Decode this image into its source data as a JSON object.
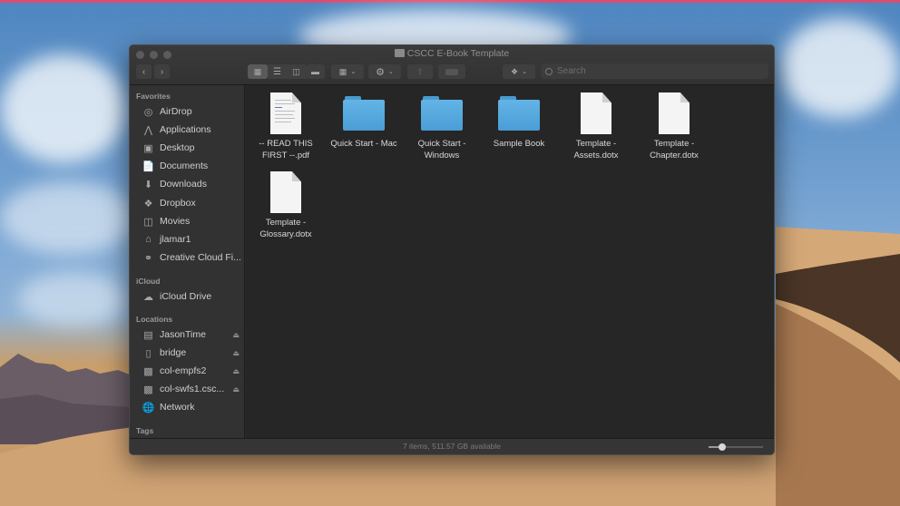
{
  "desktop": {
    "accent_line": "#d94d72"
  },
  "window": {
    "title": "CSCC E-Book Template",
    "toolbar": {
      "back_icon": "chevron-left",
      "forward_icon": "chevron-right",
      "view_modes": [
        "icon-view",
        "list-view",
        "column-view",
        "gallery-view"
      ],
      "selected_view": "icon-view",
      "group_icon": "group-grid",
      "action_icon": "gear",
      "share_icon": "share",
      "tags_icon": "tag",
      "dropbox_icon": "dropbox",
      "search_placeholder": "Search"
    },
    "sidebar": {
      "favorites_label": "Favorites",
      "favorites": [
        {
          "label": "AirDrop",
          "icon": "airdrop"
        },
        {
          "label": "Applications",
          "icon": "applications"
        },
        {
          "label": "Desktop",
          "icon": "desktop"
        },
        {
          "label": "Documents",
          "icon": "documents"
        },
        {
          "label": "Downloads",
          "icon": "downloads"
        },
        {
          "label": "Dropbox",
          "icon": "dropbox"
        },
        {
          "label": "Movies",
          "icon": "movies"
        },
        {
          "label": "jlamar1",
          "icon": "home"
        },
        {
          "label": "Creative Cloud Fi...",
          "icon": "creative-cloud"
        }
      ],
      "icloud_label": "iCloud",
      "icloud": [
        {
          "label": "iCloud Drive",
          "icon": "cloud"
        }
      ],
      "locations_label": "Locations",
      "locations": [
        {
          "label": "JasonTime",
          "icon": "time-machine",
          "ejectable": true
        },
        {
          "label": "bridge",
          "icon": "drive",
          "ejectable": true
        },
        {
          "label": "col-empfs2",
          "icon": "server",
          "ejectable": true
        },
        {
          "label": "col-swfs1.csc...",
          "icon": "server",
          "ejectable": true
        },
        {
          "label": "Network",
          "icon": "network",
          "ejectable": false
        }
      ],
      "tags_label": "Tags"
    },
    "files": [
      {
        "name": "-- READ THIS FIRST --.pdf",
        "line1": "-- READ THIS",
        "line2": "FIRST --.pdf",
        "type": "pdf"
      },
      {
        "name": "Quick Start - Mac",
        "line1": "Quick Start - Mac",
        "line2": "",
        "type": "folder"
      },
      {
        "name": "Quick Start - Windows",
        "line1": "Quick Start -",
        "line2": "Windows",
        "type": "folder"
      },
      {
        "name": "Sample Book",
        "line1": "Sample Book",
        "line2": "",
        "type": "folder"
      },
      {
        "name": "Template - Assets.dotx",
        "line1": "Template -",
        "line2": "Assets.dotx",
        "type": "dotx"
      },
      {
        "name": "Template - Chapter.dotx",
        "line1": "Template -",
        "line2": "Chapter.dotx",
        "type": "dotx"
      },
      {
        "name": "Template - Glossary.dotx",
        "line1": "Template -",
        "line2": "Glossary.dotx",
        "type": "dotx"
      }
    ],
    "status": {
      "text": "7 items, 511.57 GB available",
      "icon_size_fraction": 0.25
    }
  }
}
